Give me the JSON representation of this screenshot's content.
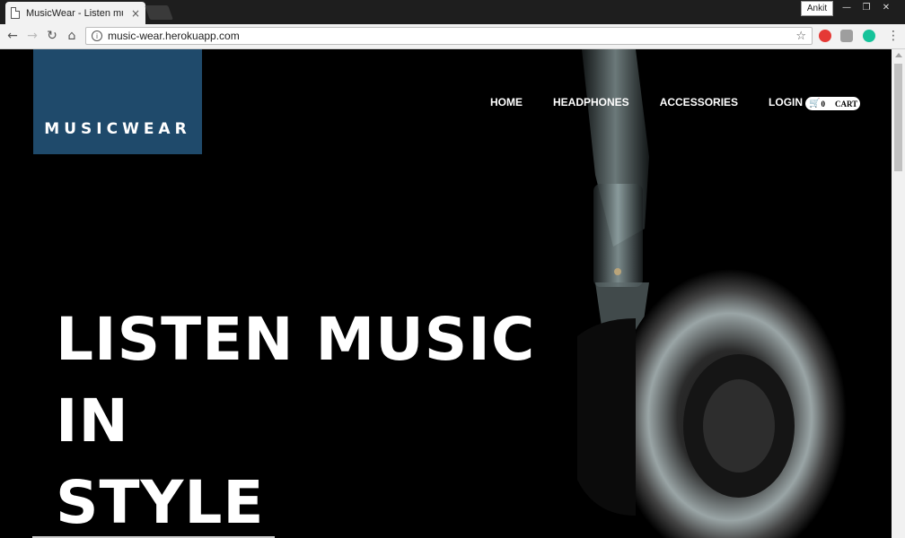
{
  "browser": {
    "tab_title": "MusicWear - Listen musi",
    "tab_close": "×",
    "profile_name": "Ankit",
    "url": "music-wear.herokuapp.com",
    "window_controls": [
      "minimize-icon",
      "restore-icon",
      "close-icon"
    ],
    "extensions": [
      {
        "name": "opera-extension-icon",
        "color": "#e53935"
      },
      {
        "name": "generic-extension-icon",
        "color": "#9e9e9e"
      },
      {
        "name": "grammarly-extension-icon",
        "color": "#15c39a"
      }
    ]
  },
  "site": {
    "logo": "MUSICWEAR",
    "nav": [
      "HOME",
      "HEADPHONES",
      "ACCESSORIES",
      "LOGIN"
    ],
    "cart": {
      "count": "0",
      "label": "CART"
    },
    "hero": {
      "line1": "LISTEN MUSIC IN",
      "line2": "STYLE"
    },
    "colors": {
      "logo_bg": "#1f4a6b",
      "page_bg": "#000000"
    }
  }
}
